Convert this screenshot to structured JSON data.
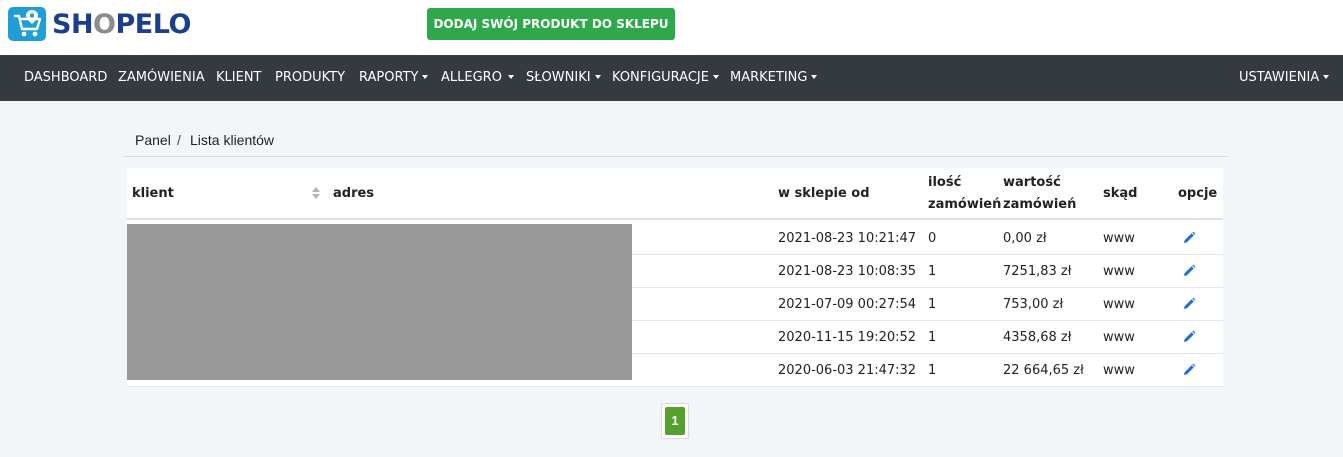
{
  "brand": {
    "logo_prefix": "SH",
    "logo_o": "O",
    "logo_suffix": "PELO"
  },
  "header": {
    "cta_label": "DODAJ SWÓJ PRODUKT DO SKLEPU",
    "cta_color": "#2ea84a"
  },
  "nav": {
    "items": [
      {
        "label": "DASHBOARD",
        "dropdown": false
      },
      {
        "label": "ZAMÓWIENIA",
        "dropdown": false
      },
      {
        "label": "KLIENT",
        "dropdown": false
      },
      {
        "label": "PRODUKTY",
        "dropdown": false
      },
      {
        "label": "RAPORTY",
        "dropdown": true
      },
      {
        "label": "ALLEGRO",
        "dropdown": true
      },
      {
        "label": "SŁOWNIKI",
        "dropdown": true
      },
      {
        "label": "KONFIGURACJE",
        "dropdown": true
      },
      {
        "label": "MARKETING",
        "dropdown": true
      }
    ],
    "settings_label": "USTAWIENIA",
    "background": "#343a40"
  },
  "breadcrumb": {
    "home": "Panel",
    "separator": "/",
    "current": "Lista klientów"
  },
  "table": {
    "headers": {
      "client": "klient",
      "address": "adres",
      "since": "w sklepie od",
      "orders_count_line1": "ilość",
      "orders_count_line2": "zamówień",
      "orders_value_line1": "wartość",
      "orders_value_line2": "zamówień",
      "source": "skąd",
      "options": "opcje"
    },
    "rows": [
      {
        "since": "2021-08-23 10:21:47",
        "orders_count": "0",
        "orders_value": "0,00 zł",
        "source": "www"
      },
      {
        "since": "2021-08-23 10:08:35",
        "orders_count": "1",
        "orders_value": "7251,83 zł",
        "source": "www"
      },
      {
        "since": "2021-07-09 00:27:54",
        "orders_count": "1",
        "orders_value": "753,00 zł",
        "source": "www"
      },
      {
        "since": "2020-11-15 19:20:52",
        "orders_count": "1",
        "orders_value": "4358,68 zł",
        "source": "www"
      },
      {
        "since": "2020-06-03 21:47:32",
        "orders_count": "1",
        "orders_value": "22 664,65 zł",
        "source": "www"
      }
    ],
    "icons": {
      "sort": "sort-icon",
      "edit": "pencil-icon"
    },
    "edit_icon_color": "#1e6fd9"
  },
  "pagination": {
    "current_page": "1",
    "active_color": "#55a12c"
  }
}
